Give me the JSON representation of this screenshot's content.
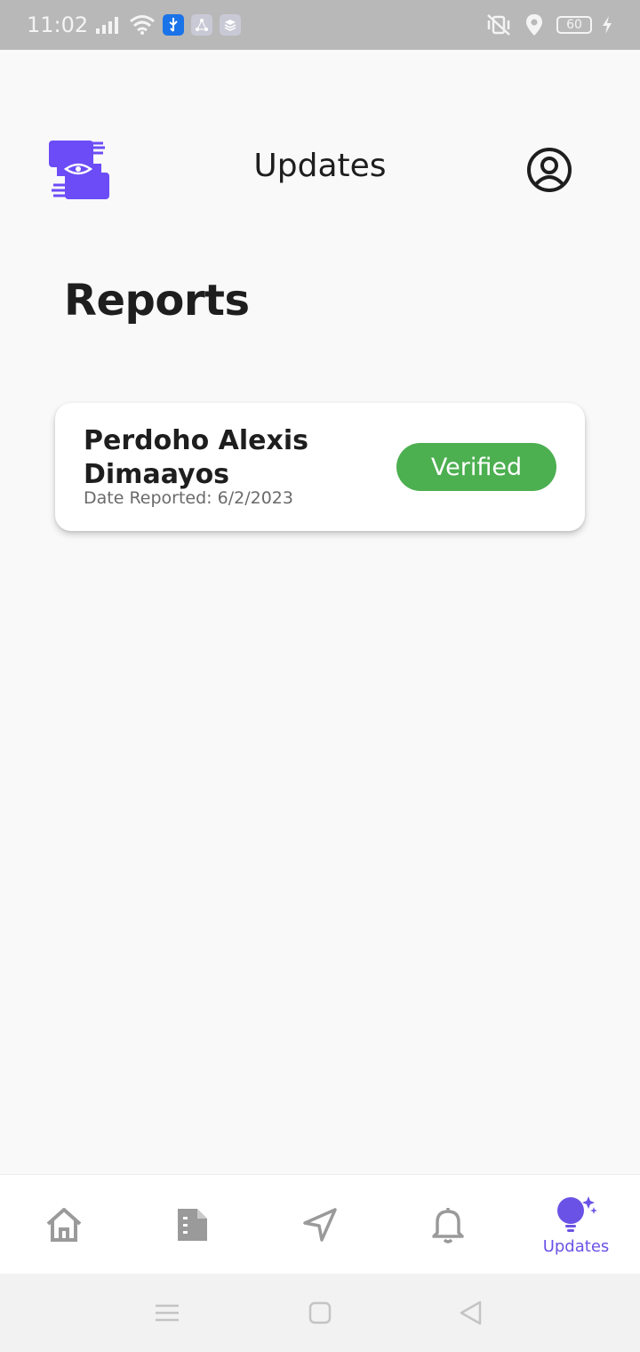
{
  "status_bar": {
    "time": "11:02",
    "battery": "60"
  },
  "header": {
    "title": "Updates"
  },
  "section": {
    "title": "Reports"
  },
  "reports": [
    {
      "name": "Perdoho Alexis Dimaayos",
      "date_label": "Date Reported: 6/2/2023",
      "status": "Verified"
    }
  ],
  "bottom_nav": {
    "items": [
      {
        "icon": "home-icon"
      },
      {
        "icon": "document-icon"
      },
      {
        "icon": "send-icon"
      },
      {
        "icon": "bell-icon"
      },
      {
        "icon": "lightbulb-icon",
        "label": "Updates",
        "active": true
      }
    ]
  },
  "colors": {
    "accent": "#6b52e6",
    "verified": "#4caf50",
    "logo": "#6b4cf6"
  }
}
